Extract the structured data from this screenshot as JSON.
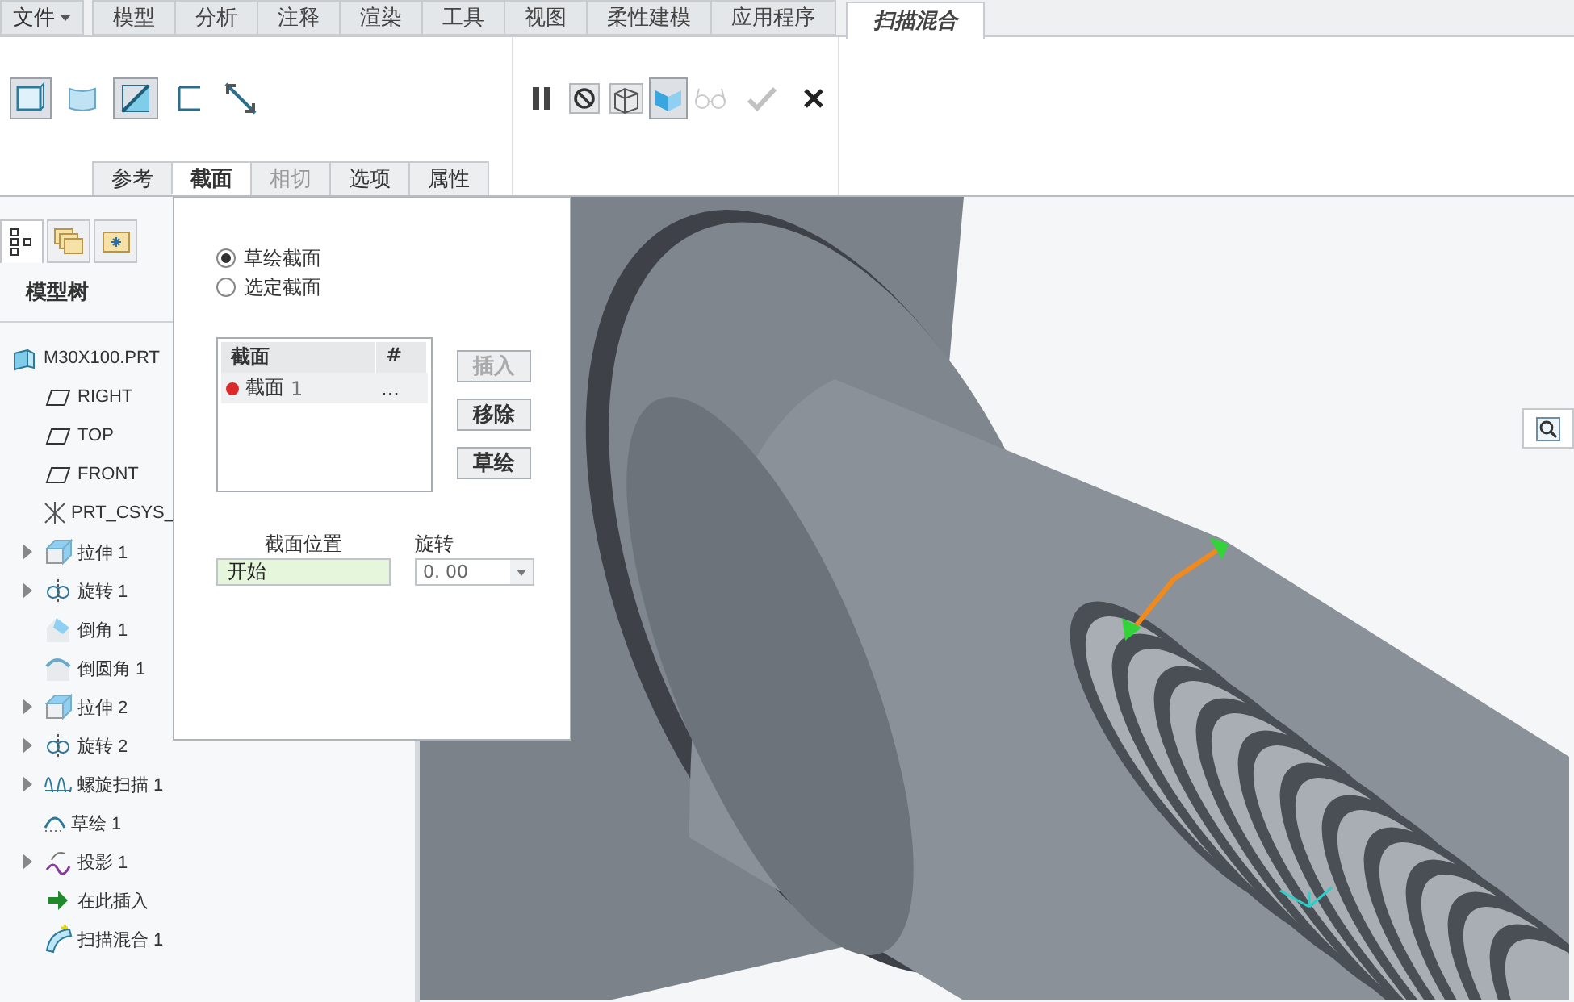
{
  "menu_tabs": {
    "file_menu": "文件",
    "tabs": [
      {
        "label": "模型",
        "selected": false
      },
      {
        "label": "分析",
        "selected": false
      },
      {
        "label": "注释",
        "selected": false
      },
      {
        "label": "渲染",
        "selected": false
      },
      {
        "label": "工具",
        "selected": false
      },
      {
        "label": "视图",
        "selected": false
      },
      {
        "label": "柔性建模",
        "selected": false
      },
      {
        "label": "应用程序",
        "selected": false
      },
      {
        "label": "扫描混合",
        "selected": true
      }
    ]
  },
  "ribbon": {
    "shape_tools": [
      {
        "kind": "solid",
        "pressed": true
      },
      {
        "kind": "surface",
        "pressed": false
      },
      {
        "kind": "remove",
        "pressed": true
      },
      {
        "kind": "thin",
        "pressed": false
      },
      {
        "kind": "flip",
        "pressed": false
      }
    ],
    "control_tools": [
      {
        "kind": "pause",
        "pressed": false,
        "disabled": false
      },
      {
        "kind": "no_preview",
        "pressed": false,
        "disabled": false
      },
      {
        "kind": "wire_preview",
        "pressed": false,
        "disabled": false
      },
      {
        "kind": "shaded_preview",
        "pressed": true,
        "disabled": false
      },
      {
        "kind": "glasses",
        "pressed": false,
        "disabled": true
      },
      {
        "kind": "ok",
        "pressed": false,
        "disabled": true
      },
      {
        "kind": "cancel",
        "pressed": false,
        "disabled": false
      }
    ],
    "panel_tabs": [
      {
        "label": "参考",
        "selected": false,
        "disabled": false
      },
      {
        "label": "截面",
        "selected": true,
        "disabled": false
      },
      {
        "label": "相切",
        "selected": false,
        "disabled": true
      },
      {
        "label": "选项",
        "selected": false,
        "disabled": false
      },
      {
        "label": "属性",
        "selected": false,
        "disabled": false
      }
    ]
  },
  "sidebar": {
    "tabs": [
      {
        "kind": "tree",
        "selected": true
      },
      {
        "kind": "folders",
        "selected": false
      },
      {
        "kind": "favorites",
        "selected": false
      }
    ],
    "title": "模型树",
    "tree": [
      {
        "kind": "part",
        "label": "M30X100.PRT",
        "children": [
          {
            "kind": "plane",
            "label": "RIGHT"
          },
          {
            "kind": "plane",
            "label": "TOP"
          },
          {
            "kind": "plane",
            "label": "FRONT"
          },
          {
            "kind": "csys",
            "label": "PRT_CSYS_"
          },
          {
            "kind": "extrude",
            "label": "拉伸 1",
            "expanded": false
          },
          {
            "kind": "revolve",
            "label": "旋转 1",
            "expanded": false
          },
          {
            "kind": "chamfer",
            "label": "倒角 1"
          },
          {
            "kind": "round",
            "label": "倒圆角 1"
          },
          {
            "kind": "extrude",
            "label": "拉伸 2",
            "expanded": false
          },
          {
            "kind": "revolve",
            "label": "旋转 2",
            "expanded": false
          },
          {
            "kind": "helix",
            "label": "螺旋扫描 1",
            "expanded": false
          },
          {
            "kind": "sketch",
            "label": "草绘 1"
          },
          {
            "kind": "projection",
            "label": "投影 1",
            "expanded": false
          },
          {
            "kind": "insert",
            "label": "在此插入"
          },
          {
            "kind": "sweep_blend",
            "label": "扫描混合 1"
          }
        ]
      }
    ]
  },
  "sections_panel": {
    "options": [
      {
        "label": "草绘截面",
        "selected": true
      },
      {
        "label": "选定截面",
        "selected": false
      }
    ],
    "table": {
      "columns": [
        "截面",
        "#"
      ],
      "rows": [
        {
          "name": "截面",
          "number": "1",
          "value": "...",
          "color": "#d92b2b"
        }
      ]
    },
    "buttons": [
      {
        "label": "插入",
        "disabled": true
      },
      {
        "label": "移除",
        "disabled": false
      },
      {
        "label": "草绘",
        "disabled": false
      }
    ],
    "position": {
      "label": "截面位置",
      "value": "开始"
    },
    "rotation": {
      "label": "旋转",
      "value": "0. 00"
    }
  }
}
